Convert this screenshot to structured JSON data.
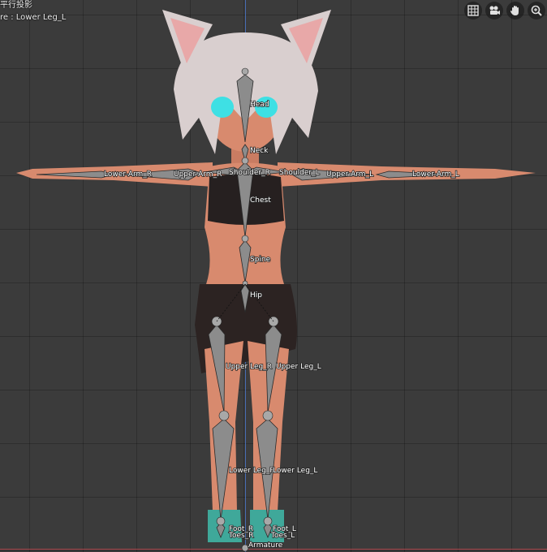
{
  "viewport": {
    "view_name": "平行投影",
    "active_object_text": "re : Lower Leg_L"
  },
  "gizmos": [
    {
      "name": "toggle-camera-grid",
      "icon": "grid-icon"
    },
    {
      "name": "camera-view",
      "icon": "camera-icon"
    },
    {
      "name": "pan-view",
      "icon": "hand-icon"
    },
    {
      "name": "zoom-view",
      "icon": "zoom-icon"
    }
  ],
  "bones": {
    "head": "Head",
    "neck": "Neck",
    "chest": "Chest",
    "spine": "Spine",
    "hip": "Hip",
    "shoulder_r": "Shoulder_R",
    "shoulder_l": "Shoulder_L",
    "upper_arm_r": "Upper Arm_R",
    "upper_arm_l": "Upper Arm_L",
    "lower_arm_r": "Lower Arm_R",
    "lower_arm_l": "Lower Arm_L",
    "upper_leg_r": "Upper Leg_R",
    "upper_leg_l": "Upper Leg_L",
    "lower_leg_r": "Lower Leg_R",
    "lower_leg_l": "Lower Leg_L",
    "foot_r": "Foot_R",
    "foot_l": "Foot_L",
    "toes_r": "Toes_R",
    "toes_l": "Toes_L",
    "armature": "Armature"
  },
  "colors": {
    "grid_bg": "#3b3b3b",
    "axis_z": "#4b77c9",
    "axis_x": "#b6464c",
    "bone_fill": "#8c8c8c",
    "skin": "#d88a6e",
    "hair": "#d9cfcf"
  }
}
